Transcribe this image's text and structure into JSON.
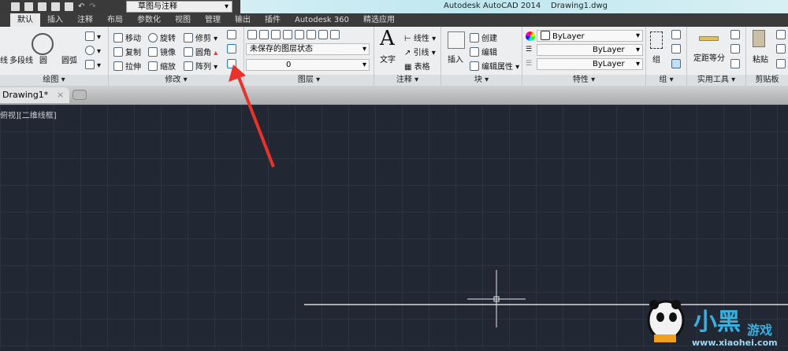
{
  "titlebar": {
    "app_title": "Autodesk AutoCAD 2014",
    "file": "Drawing1.dwg",
    "workspace": "草图与注释"
  },
  "tabs": [
    "默认",
    "插入",
    "注释",
    "布局",
    "参数化",
    "视图",
    "管理",
    "输出",
    "插件",
    "Autodesk 360",
    "精选应用"
  ],
  "panels": {
    "draw": {
      "label": "绘图",
      "items": [
        "线",
        "多段线",
        "圆",
        "圆弧"
      ]
    },
    "modify": {
      "label": "修改",
      "items": [
        "移动",
        "旋转",
        "修剪",
        "复制",
        "镜像",
        "圆角",
        "拉伸",
        "缩放",
        "阵列"
      ]
    },
    "layers": {
      "label": "图层",
      "state": "未保存的图层状态",
      "layer": "0"
    },
    "annotation": {
      "label": "注释",
      "text": "文字",
      "items": [
        "线性",
        "引线",
        "表格"
      ]
    },
    "block": {
      "label": "块",
      "insert": "插入",
      "items": [
        "创建",
        "编辑",
        "编辑属性"
      ]
    },
    "properties": {
      "label": "特性",
      "color": "ByLayer",
      "linetype": "ByLayer",
      "lineweight": "ByLayer"
    },
    "groups": {
      "label": "组",
      "group": "组"
    },
    "utilities": {
      "label": "实用工具",
      "measure": "定距等分"
    },
    "clipboard": {
      "label": "剪贴板",
      "paste": "粘贴"
    }
  },
  "document": {
    "tab": "Drawing1*",
    "view_label": "俯视][二维线框]"
  },
  "watermark": {
    "brand": "小黑游戏",
    "url": "www.xiaohei.com"
  },
  "colors": {
    "canvas": "#212833",
    "arrow": "#e8322b"
  }
}
